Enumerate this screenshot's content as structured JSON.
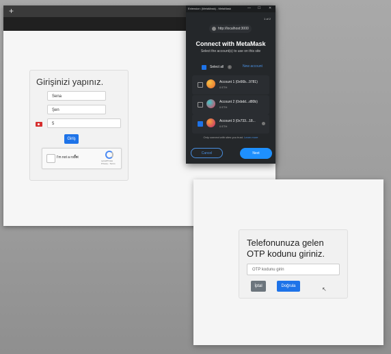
{
  "browser": {
    "new_tab_label": "+",
    "login": {
      "title": "Girişinizi yapınız.",
      "first_name": "Sena",
      "last_name": "Şen",
      "phone": "5",
      "submit_label": "Giriş",
      "recaptcha": {
        "label": "I'm not a robot",
        "brand": "reCAPTCHA",
        "links": "Privacy - Terms"
      }
    }
  },
  "metamask": {
    "window_title": "Extension: (MetaMask) - MetaMask",
    "window_controls": [
      "—",
      "☐",
      "✕"
    ],
    "step": "1 of 2",
    "origin": "http://localhost:3000",
    "title": "Connect with MetaMask",
    "subtitle": "Select the account(s) to use on this site",
    "select_all": "Select all",
    "new_account": "New account",
    "accounts": [
      {
        "name": "Account 1 (0x66b...9781)",
        "balance": "0 ETH",
        "checked": false,
        "color": "#f29a3a"
      },
      {
        "name": "Account 2 (0xbdd...d80b)",
        "balance": "0 ETH",
        "checked": false,
        "color": "#e5533d"
      },
      {
        "name": "Account 3 (0x733...18...",
        "balance": "0 ETH",
        "checked": true,
        "color": "#d9473b"
      }
    ],
    "trust_note": "Only connect with sites you trust.",
    "learn_more": "Learn more",
    "cancel_label": "Cancel",
    "next_label": "Next"
  },
  "otp": {
    "title": "Telefonunuza gelen OTP kodunu giriniz.",
    "input_placeholder": "OTP kodunu girin",
    "cancel_label": "İptal",
    "verify_label": "Doğrula"
  }
}
